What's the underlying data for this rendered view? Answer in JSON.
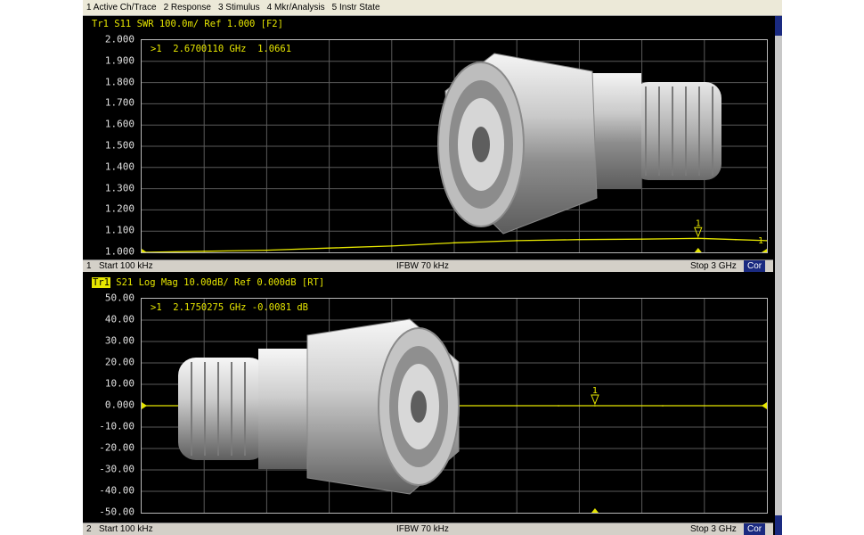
{
  "menu": [
    "1 Active Ch/Trace",
    "2 Response",
    "3 Stimulus",
    "4 Mkr/Analysis",
    "5 Instr State"
  ],
  "colors": {
    "trace": "#e6e600",
    "grid": "#5a5a5a",
    "background": "#000000",
    "statusbar": "#d4d0c8",
    "cor_badge": "#1a2a80"
  },
  "channel1": {
    "header": "Tr1 S11 SWR 100.0m/ Ref 1.000 [F2]",
    "marker": ">1  2.6700110 GHz  1.0661",
    "marker_label": "1",
    "end_label": "1",
    "yticks": [
      "2.000",
      "1.900",
      "1.800",
      "1.700",
      "1.600",
      "1.500",
      "1.400",
      "1.300",
      "1.200",
      "1.100",
      "1.000"
    ],
    "status": {
      "channel": "1",
      "start": "Start 100 kHz",
      "ifbw": "IFBW 70 kHz",
      "stop": "Stop 3 GHz",
      "cor": "Cor"
    }
  },
  "channel2": {
    "header_tag": "Tr1",
    "header": " S21 Log Mag 10.00dB/ Ref 0.000dB [RT]",
    "marker": ">1  2.1750275 GHz -0.0081 dB",
    "marker_label": "1",
    "yticks": [
      "50.00",
      "40.00",
      "30.00",
      "20.00",
      "10.00",
      "0.000",
      "-10.00",
      "-20.00",
      "-30.00",
      "-40.00",
      "-50.00"
    ],
    "status": {
      "channel": "2",
      "start": "Start 100 kHz",
      "ifbw": "IFBW 70 kHz",
      "stop": "Stop 3 GHz",
      "cor": "Cor"
    }
  },
  "chart_data": [
    {
      "type": "line",
      "xlim": [
        0.0001,
        3.0
      ],
      "ylim": [
        1.0,
        2.0
      ],
      "x": [
        0.0001,
        0.3,
        0.6,
        0.9,
        1.2,
        1.5,
        1.8,
        2.1,
        2.4,
        2.67,
        2.85,
        3.0
      ],
      "series": [
        {
          "values": [
            1.0,
            1.005,
            1.01,
            1.02,
            1.03,
            1.045,
            1.055,
            1.06,
            1.062,
            1.066,
            1.06,
            1.055
          ]
        }
      ]
    },
    {
      "type": "line",
      "xlim": [
        0.0001,
        3.0
      ],
      "ylim": [
        -50,
        50
      ],
      "x": [
        0.0001,
        0.5,
        1.0,
        1.5,
        2.0,
        2.175,
        2.5,
        3.0
      ],
      "series": [
        {
          "values": [
            0,
            0,
            0,
            -0.01,
            -0.01,
            -0.0081,
            -0.01,
            0
          ]
        }
      ]
    }
  ]
}
